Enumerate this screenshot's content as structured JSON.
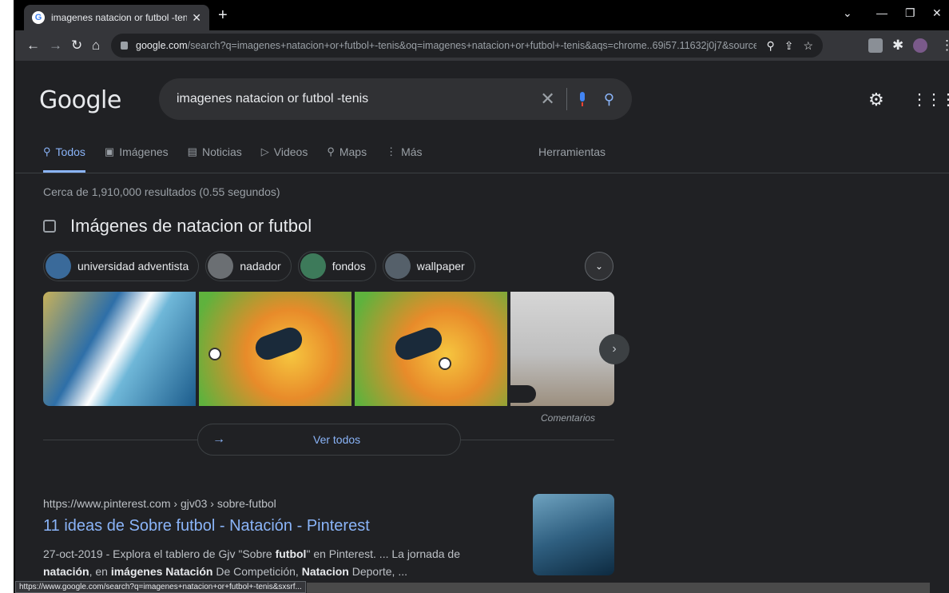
{
  "browser": {
    "tab_title": "imagenes natacion or futbol -ten",
    "url_domain": "google.com",
    "url_rest": "/search?q=imagenes+natacion+or+futbol+-tenis&oq=imagenes+natacion+or+futbol+-tenis&aqs=chrome..69i57.11632j0j7&sourceid=...",
    "status_url": "https://www.google.com/search?q=imagenes+natacion+or+futbol+-tenis&sxsrf..."
  },
  "search": {
    "logo": "Google",
    "query": "imagenes natacion or futbol -tenis"
  },
  "nav": {
    "todos": "Todos",
    "imagenes": "Imágenes",
    "noticias": "Noticias",
    "videos": "Videos",
    "maps": "Maps",
    "mas": "Más",
    "herramientas": "Herramientas"
  },
  "stats": "Cerca de 1,910,000 resultados (0.55 segundos)",
  "images_section": {
    "title": "Imágenes de natacion or futbol",
    "chips": [
      "universidad adventista",
      "nadador",
      "fondos",
      "wallpaper"
    ],
    "comment": "Comentarios",
    "see_all": "Ver todos"
  },
  "result": {
    "url": "https://www.pinterest.com › gjv03 › sobre-futbol",
    "title": "11 ideas de Sobre futbol - Natación - Pinterest",
    "snippet_a": "27-oct-2019 - Explora el tablero de Gjv \"Sobre ",
    "snippet_b": "futbol",
    "snippet_c": "\" en Pinterest. ... La jornada de",
    "snippet_d": "natación",
    "snippet_e": ", en ",
    "snippet_f": "imágenes Natación",
    "snippet_g": " De Competición, ",
    "snippet_h": "Natacion",
    "snippet_i": " Deporte, ..."
  },
  "colors": {
    "bg": "#202124",
    "link": "#8ab4f8",
    "text": "#bdc1c6"
  }
}
